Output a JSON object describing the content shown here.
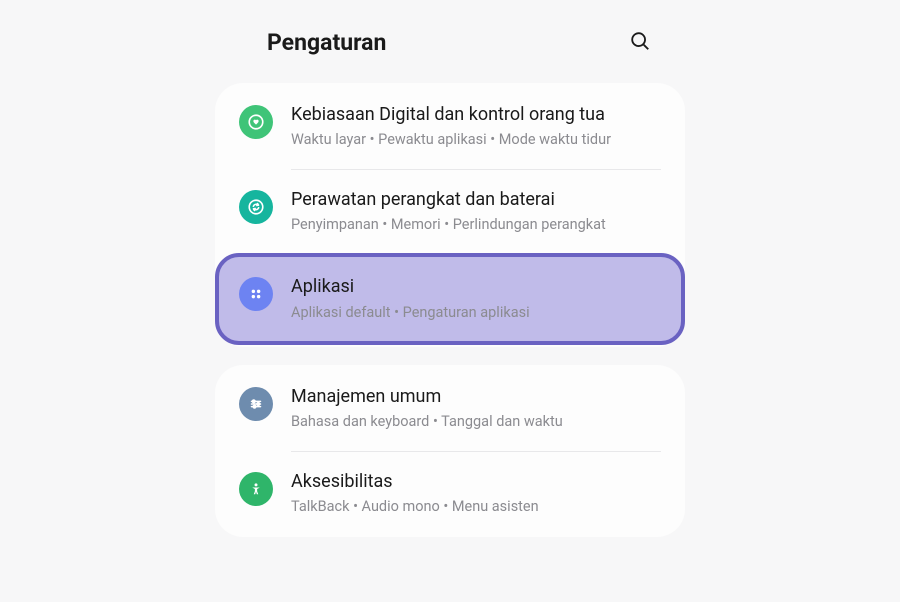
{
  "header": {
    "title": "Pengaturan"
  },
  "groups": [
    {
      "items": [
        {
          "key": "digital-wellbeing",
          "icon": "heart-circle",
          "iconClass": "icon-green",
          "title": "Kebiasaan Digital dan kontrol orang tua",
          "subtitle": "Waktu layar  •  Pewaktu aplikasi  •  Mode waktu tidur"
        },
        {
          "key": "device-care",
          "icon": "refresh-circle",
          "iconClass": "icon-teal",
          "title": "Perawatan perangkat dan baterai",
          "subtitle": "Penyimpanan  •  Memori  •  Perlindungan perangkat"
        },
        {
          "key": "apps",
          "icon": "grid-dots",
          "iconClass": "icon-blue",
          "title": "Aplikasi",
          "subtitle": "Aplikasi default  •  Pengaturan aplikasi",
          "highlighted": true
        }
      ]
    },
    {
      "items": [
        {
          "key": "general",
          "icon": "sliders",
          "iconClass": "icon-bluegray",
          "title": "Manajemen umum",
          "subtitle": "Bahasa dan keyboard  •  Tanggal dan waktu"
        },
        {
          "key": "accessibility",
          "icon": "person",
          "iconClass": "icon-access",
          "title": "Aksesibilitas",
          "subtitle": "TalkBack  •  Audio mono  •  Menu asisten"
        }
      ]
    }
  ]
}
